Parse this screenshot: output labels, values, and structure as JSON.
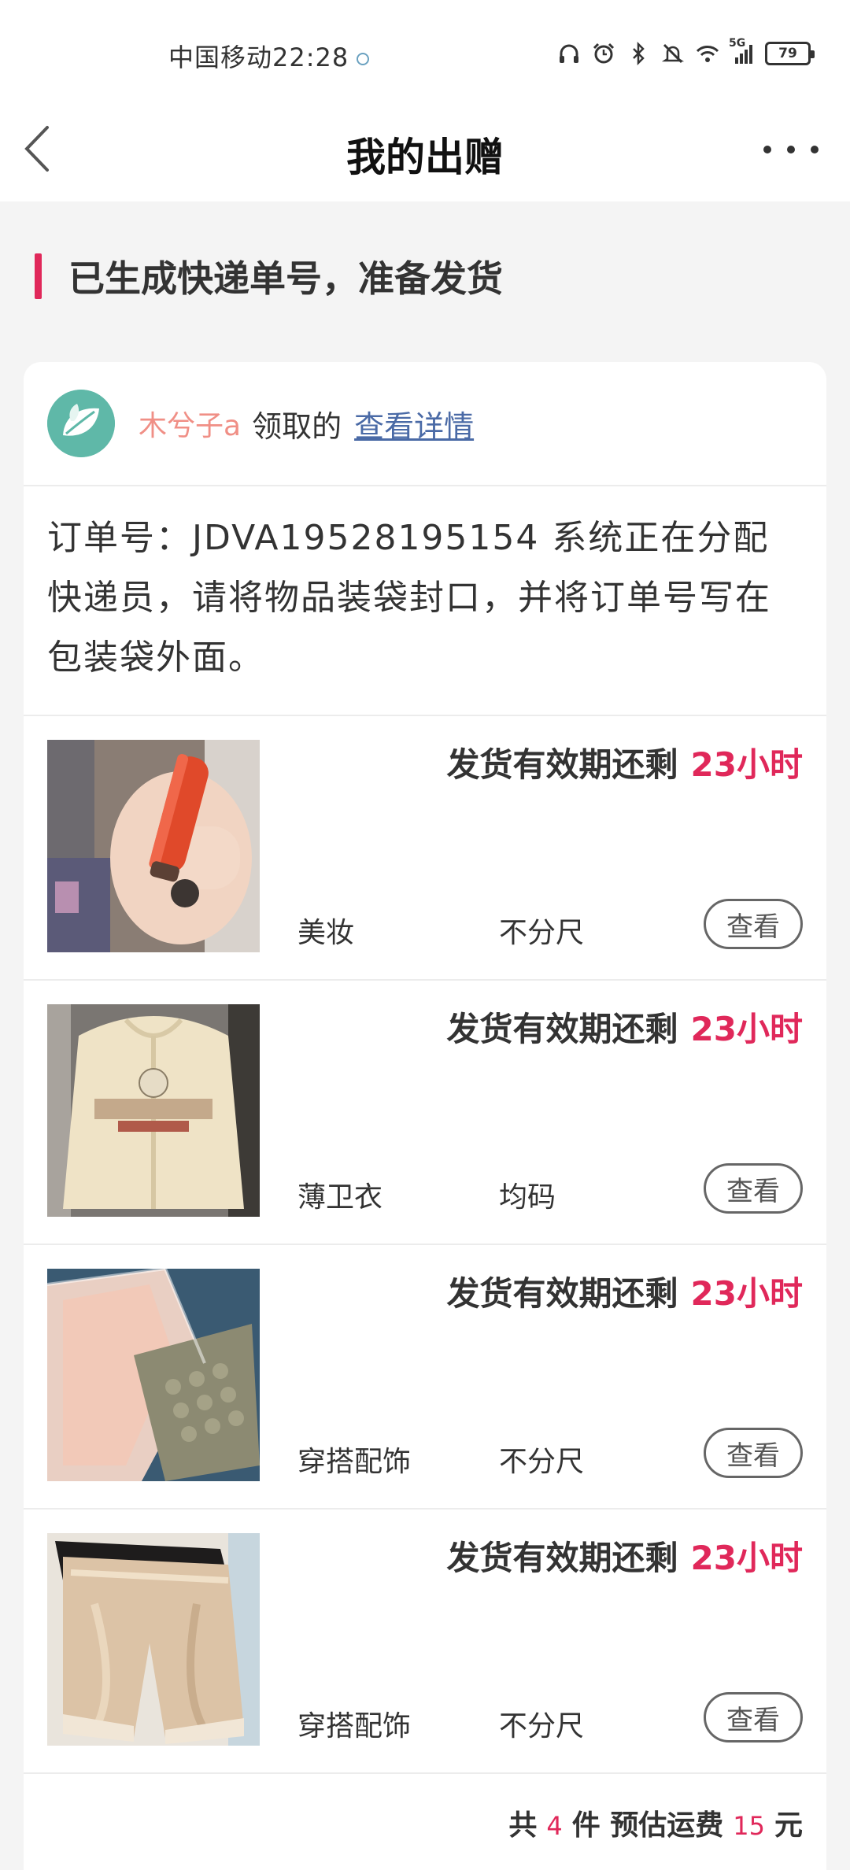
{
  "status_bar": {
    "carrier": "中国移动",
    "time": "22:28",
    "battery": "79",
    "network": "5G",
    "icons": [
      "headphones-icon",
      "alarm-icon",
      "bluetooth-icon",
      "mute-icon",
      "wifi-icon",
      "signal-icon",
      "battery-icon"
    ]
  },
  "header": {
    "title": "我的出赠"
  },
  "section": {
    "title": "已生成快递单号，准备发货"
  },
  "receiver": {
    "name": "木兮子a",
    "action": "领取的",
    "link": "查看详情"
  },
  "order_note": "订单号：JDVA19528195154 系统正在分配快递员，请将物品装袋封口，并将订单号写在包装袋外面。",
  "items": [
    {
      "deadline_label": "发货有效期还剩",
      "deadline_value": "23小时",
      "category": "美妆",
      "size": "不分尺",
      "button": "查看",
      "image": "lipstick-photo"
    },
    {
      "deadline_label": "发货有效期还剩",
      "deadline_value": "23小时",
      "category": "薄卫衣",
      "size": "均码",
      "button": "查看",
      "image": "hoodie-photo"
    },
    {
      "deadline_label": "发货有效期还剩",
      "deadline_value": "23小时",
      "category": "穿搭配饰",
      "size": "不分尺",
      "button": "查看",
      "image": "accessories-photo"
    },
    {
      "deadline_label": "发货有效期还剩",
      "deadline_value": "23小时",
      "category": "穿搭配饰",
      "size": "不分尺",
      "button": "查看",
      "image": "shorts-photo"
    }
  ],
  "summary": {
    "prefix": "共",
    "count": "4",
    "unit": "件 预估运费",
    "fee": "15",
    "currency": "元"
  },
  "colors": {
    "accent": "#e0285a",
    "link": "#4a6aa6",
    "receiver_name": "#f08f86"
  }
}
